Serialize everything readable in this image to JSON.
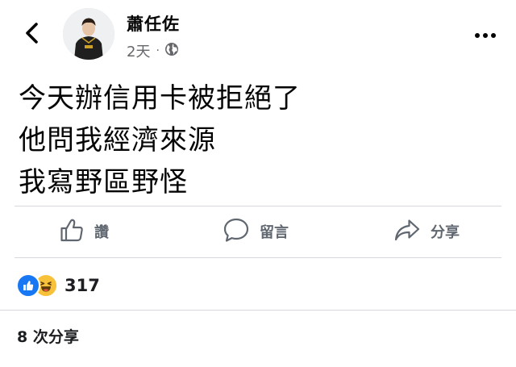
{
  "header": {
    "back_icon": "chevron-left-icon",
    "author_name": "蕭任佐",
    "time_ago": "2天",
    "separator": "·",
    "audience_icon": "globe-icon",
    "more_icon": "more-horizontal-icon"
  },
  "post": {
    "lines": [
      "今天辦信用卡被拒絕了",
      "他問我經濟來源",
      "我寫野區野怪"
    ]
  },
  "actions": {
    "like_label": "讚",
    "like_icon": "thumbs-up-icon",
    "comment_label": "留言",
    "comment_icon": "comment-bubble-icon",
    "share_label": "分享",
    "share_icon": "share-arrow-icon"
  },
  "reactions": {
    "types": [
      "like",
      "haha"
    ],
    "count": "317"
  },
  "shares": {
    "text": "8 次分享"
  },
  "colors": {
    "text_primary": "#050505",
    "text_secondary": "#65676b",
    "action_gray": "#606770",
    "like_blue": "#1877f2",
    "haha_yellow": "#f7c13a",
    "divider": "#d6d8db"
  }
}
